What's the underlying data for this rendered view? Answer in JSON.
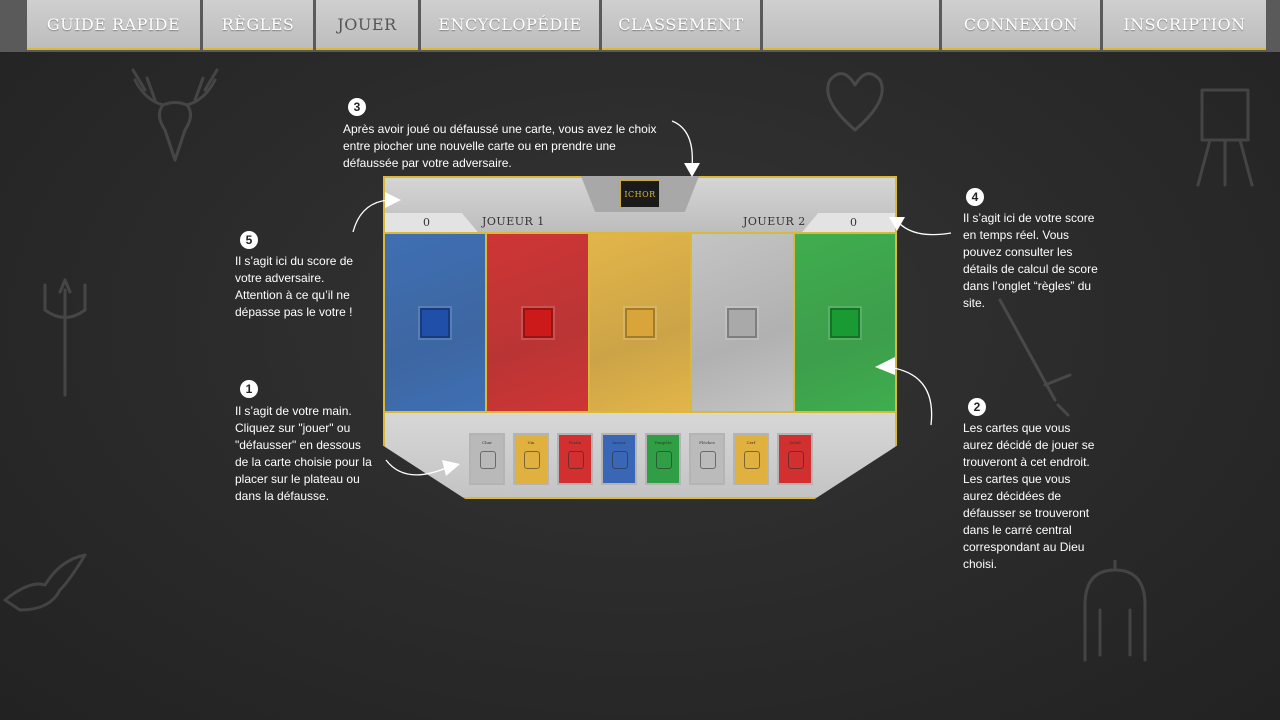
{
  "nav": {
    "items": [
      {
        "label": "GUIDE RAPIDE",
        "name": "nav-guide-rapide"
      },
      {
        "label": "RÈGLES",
        "name": "nav-regles"
      },
      {
        "label": "JOUER",
        "name": "nav-jouer",
        "active": true
      },
      {
        "label": "ENCYCLOPÉDIE",
        "name": "nav-encyclopedie"
      },
      {
        "label": "CLASSEMENT",
        "name": "nav-classement"
      },
      {
        "label": "CONNEXION",
        "name": "nav-connexion"
      },
      {
        "label": "INSCRIPTION",
        "name": "nav-inscription"
      }
    ]
  },
  "board": {
    "logo_text": "ICHOR",
    "player1": {
      "label": "JOUEUR 1",
      "score": "0"
    },
    "player2": {
      "label": "JOUEUR 2",
      "score": "0"
    },
    "columns": [
      {
        "color": "#3f6fb3",
        "square": "#1f4fa8"
      },
      {
        "color": "#cf3535",
        "square": "#cc1a1a"
      },
      {
        "color": "#e3b54a",
        "square": "#d9a53a"
      },
      {
        "color": "#c4c4c4",
        "square": "#a9a9a9"
      },
      {
        "color": "#3fae4f",
        "square": "#1a9a33"
      }
    ],
    "hand": [
      {
        "name": "Char",
        "color": "#b9b9b9",
        "icon": "hammer-icon"
      },
      {
        "name": "Vin",
        "color": "#e0b13f",
        "icon": "bottle-icon"
      },
      {
        "name": "Festin",
        "color": "#d23030",
        "icon": "cake-icon"
      },
      {
        "name": "Amour",
        "color": "#3a67b5",
        "icon": "heart-icon"
      },
      {
        "name": "Tempête",
        "color": "#2f9e44",
        "icon": "tornado-icon"
      },
      {
        "name": "Flèches",
        "color": "#bbbbbb",
        "icon": "arrows-icon"
      },
      {
        "name": "Cerf",
        "color": "#e0b13f",
        "icon": "deer-icon"
      },
      {
        "name": "Soleil",
        "color": "#d23030",
        "icon": "sun-icon"
      }
    ]
  },
  "annotations": {
    "n1": {
      "number": "1",
      "text": "Il s’agit de votre main. Cliquez sur \"jouer\" ou \"défausser\" en dessous de la carte choisie pour la placer sur le plateau ou dans la défausse."
    },
    "n2": {
      "number": "2",
      "text": "Les cartes que vous aurez décidé de jouer se trouveront à cet endroit. Les cartes que vous aurez décidées de défausser se trouveront dans le carré central correspondant au Dieu choisi."
    },
    "n3": {
      "number": "3",
      "text": "Après avoir joué ou défaussé une carte, vous avez le choix entre piocher une nouvelle carte ou en prendre une défaussée par votre adversaire."
    },
    "n4": {
      "number": "4",
      "text": "Il s’agit ici de votre score en temps réel. Vous pouvez consulter les détails de calcul de score dans l’onglet “règles” du site."
    },
    "n5": {
      "number": "5",
      "text": "Il s’agit ici du score de votre adversaire. Attention à ce qu’il ne dépasse pas le votre !"
    }
  }
}
